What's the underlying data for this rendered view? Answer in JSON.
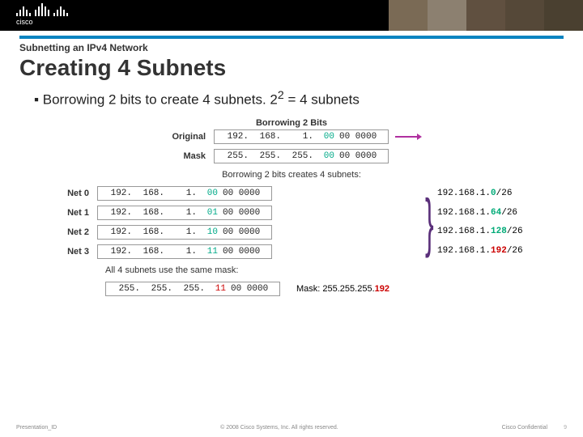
{
  "header": {
    "brand": "cisco"
  },
  "pretitle": "Subnetting an IPv4 Network",
  "title": "Creating 4 Subnets",
  "bullet": {
    "pre": "Borrowing 2 bits to create 4 subnets.  2",
    "sup": "2",
    "post": " = 4 subnets"
  },
  "diagram": {
    "title": "Borrowing 2 Bits",
    "original_label": "Original",
    "mask_label": "Mask",
    "orig_addr": {
      "o1": "192.",
      "o2": "168.",
      "o3": "1.",
      "bits": "00",
      "bin": "00 0000"
    },
    "orig_mask": {
      "o1": "255.",
      "o2": "255.",
      "o3": "255.",
      "bits": "00",
      "bin": "00 0000"
    },
    "subtitle": "Borrowing 2 bits creates 4 subnets:",
    "nets": [
      {
        "label": "Net 0",
        "o1": "192.",
        "o2": "168.",
        "o3": "1.",
        "bits": "00",
        "bin": "00 0000",
        "cidr_pre": "192.168.1.",
        "cidr_host": "0",
        "cidr_suf": "/26"
      },
      {
        "label": "Net 1",
        "o1": "192.",
        "o2": "168.",
        "o3": "1.",
        "bits": "01",
        "bin": "00 0000",
        "cidr_pre": "192.168.1.",
        "cidr_host": "64",
        "cidr_suf": "/26"
      },
      {
        "label": "Net 2",
        "o1": "192.",
        "o2": "168.",
        "o3": "1.",
        "bits": "10",
        "bin": "00 0000",
        "cidr_pre": "192.168.1.",
        "cidr_host": "128",
        "cidr_suf": "/26"
      },
      {
        "label": "Net 3",
        "o1": "192.",
        "o2": "168.",
        "o3": "1.",
        "bits": "11",
        "bin": "00 0000",
        "cidr_pre": "192.168.1.",
        "cidr_host": "192",
        "cidr_suf": "/26"
      }
    ],
    "all_mask_label": "All 4 subnets use the same mask:",
    "all_mask": {
      "o1": "255.",
      "o2": "255.",
      "o3": "255.",
      "bits": "11",
      "bin": "00 0000"
    },
    "mask_note_pre": "Mask: 255.255.255.",
    "mask_note_val": "192"
  },
  "footer": {
    "left": "Presentation_ID",
    "mid": "© 2008 Cisco Systems, Inc. All rights reserved.",
    "right": "Cisco Confidential",
    "page": "9"
  }
}
